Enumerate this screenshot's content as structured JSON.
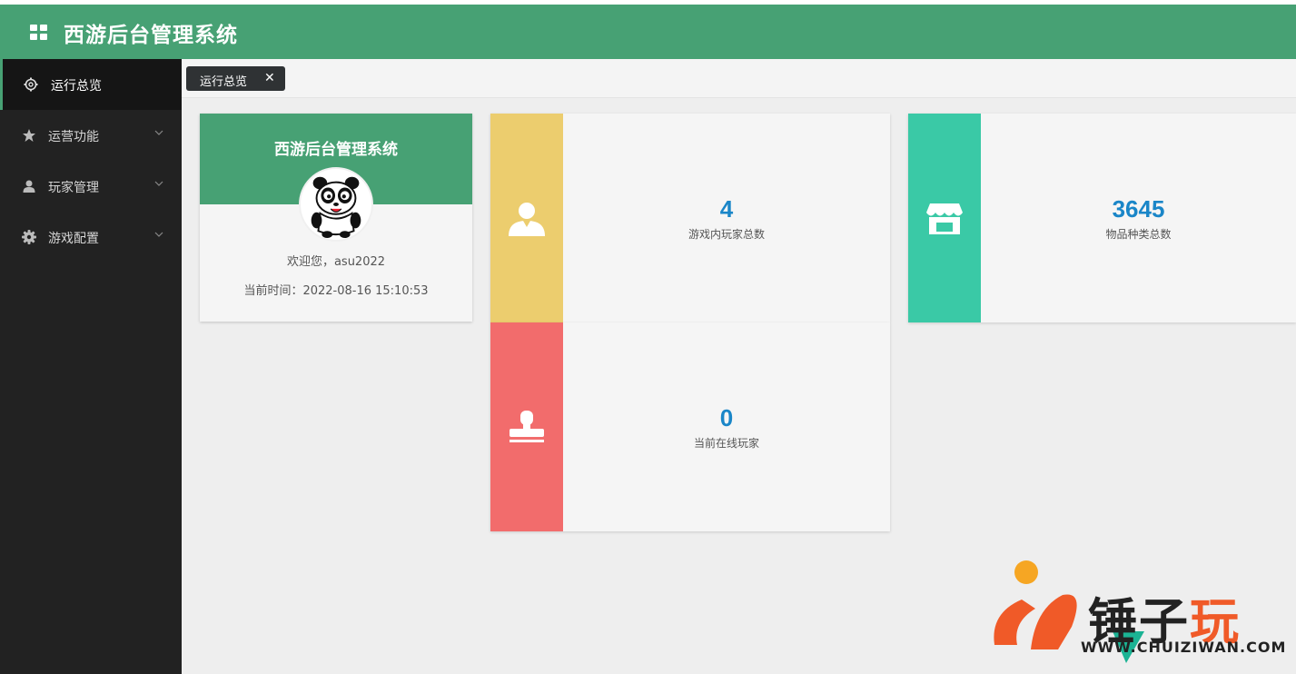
{
  "app": {
    "title": "西游后台管理系统"
  },
  "sidebar": {
    "items": [
      {
        "label": "运行总览",
        "icon": "gear-outline-icon",
        "active": true
      },
      {
        "label": "运营功能",
        "icon": "star-icon",
        "expandable": true
      },
      {
        "label": "玩家管理",
        "icon": "user-icon",
        "expandable": true
      },
      {
        "label": "游戏配置",
        "icon": "gear-icon",
        "expandable": true
      }
    ]
  },
  "tabs": [
    {
      "label": "运行总览",
      "close": "✕"
    }
  ],
  "welcome": {
    "title": "西游后台管理系统",
    "greeting": "欢迎您，asu2022",
    "time": "当前时间：2022-08-16 15:10:53"
  },
  "stats": [
    {
      "value": "4",
      "label": "游戏内玩家总数",
      "color": "#eccd6e",
      "icon": "user-icon"
    },
    {
      "value": "0",
      "label": "当前在线玩家",
      "color": "#f26c6c",
      "icon": "stamp-icon"
    },
    {
      "value": "3645",
      "label": "物品种类总数",
      "color": "#3ac9a6",
      "icon": "shop-icon"
    }
  ],
  "watermark": {
    "text": "锤子玩",
    "url": "WWW.CHUIZIWAN.COM"
  },
  "colors": {
    "brand": "#47a174",
    "sidebar": "#222222",
    "number": "#1a86c8"
  }
}
